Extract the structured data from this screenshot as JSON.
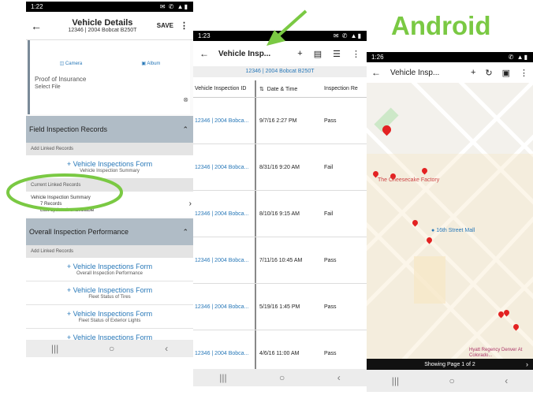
{
  "heading": "Android",
  "phone1": {
    "status_time": "1:22",
    "status_right": "N ✆ ▲▮",
    "title": "Vehicle Details",
    "subtitle": "12346 | 2004 Bobcat B250T",
    "save": "SAVE",
    "camera": "Camera",
    "album": "Album",
    "proof_label": "Proof of Insurance",
    "select_file": "Select File",
    "section1": "Field Inspection Records",
    "add_linked": "Add Linked Records",
    "form_link": "+ Vehicle Inspections Form",
    "form_sub1": "Vehicle Inspection Summary",
    "current_linked": "Current Linked Records",
    "summary_title": "Vehicle Inspection Summary",
    "summary_count": "7 Records",
    "summary_updated": "Last updated: unavailable",
    "section2": "Overall Inspection Performance",
    "add_linked2": "Add Linked Records",
    "forms": [
      {
        "title": "+ Vehicle Inspections Form",
        "sub": "Overall Inspection Performance"
      },
      {
        "title": "+ Vehicle Inspections Form",
        "sub": "Fleet Status of Tires"
      },
      {
        "title": "+ Vehicle Inspections Form",
        "sub": "Fleet Status of Exterior Lights"
      },
      {
        "title": "+ Vehicle Inspections Form",
        "sub": ""
      }
    ]
  },
  "phone2": {
    "status_time": "1:23",
    "title": "Vehicle Insp...",
    "crumb": "12346 | 2004 Bobcat B250T",
    "headers": [
      "Vehicle Inspection ID",
      "Date & Time",
      "Inspection Re"
    ],
    "rows": [
      {
        "id": "12346 | 2004 Bobca...",
        "date": "9/7/16 2:27 PM",
        "result": "Pass"
      },
      {
        "id": "12346 | 2004 Bobca...",
        "date": "8/31/16 9:20 AM",
        "result": "Fail"
      },
      {
        "id": "12346 | 2004 Bobca...",
        "date": "8/10/16 9:15 AM",
        "result": "Fail"
      },
      {
        "id": "12346 | 2004 Bobca...",
        "date": "7/11/16 10:45 AM",
        "result": "Pass"
      },
      {
        "id": "12346 | 2004 Bobca...",
        "date": "5/19/16 1:45 PM",
        "result": "Pass"
      },
      {
        "id": "12346 | 2004 Bobca...",
        "date": "4/6/16 11:00 AM",
        "result": "Pass"
      }
    ]
  },
  "phone3": {
    "status_time": "1:26",
    "title": "Vehicle Insp...",
    "map_labels": {
      "cheesecake": "The Cheesecake Factory",
      "mall": "16th Street Mall",
      "hyatt": "Hyatt Regency Denver At Colorado..."
    },
    "pager": "Showing Page 1 of 2"
  }
}
